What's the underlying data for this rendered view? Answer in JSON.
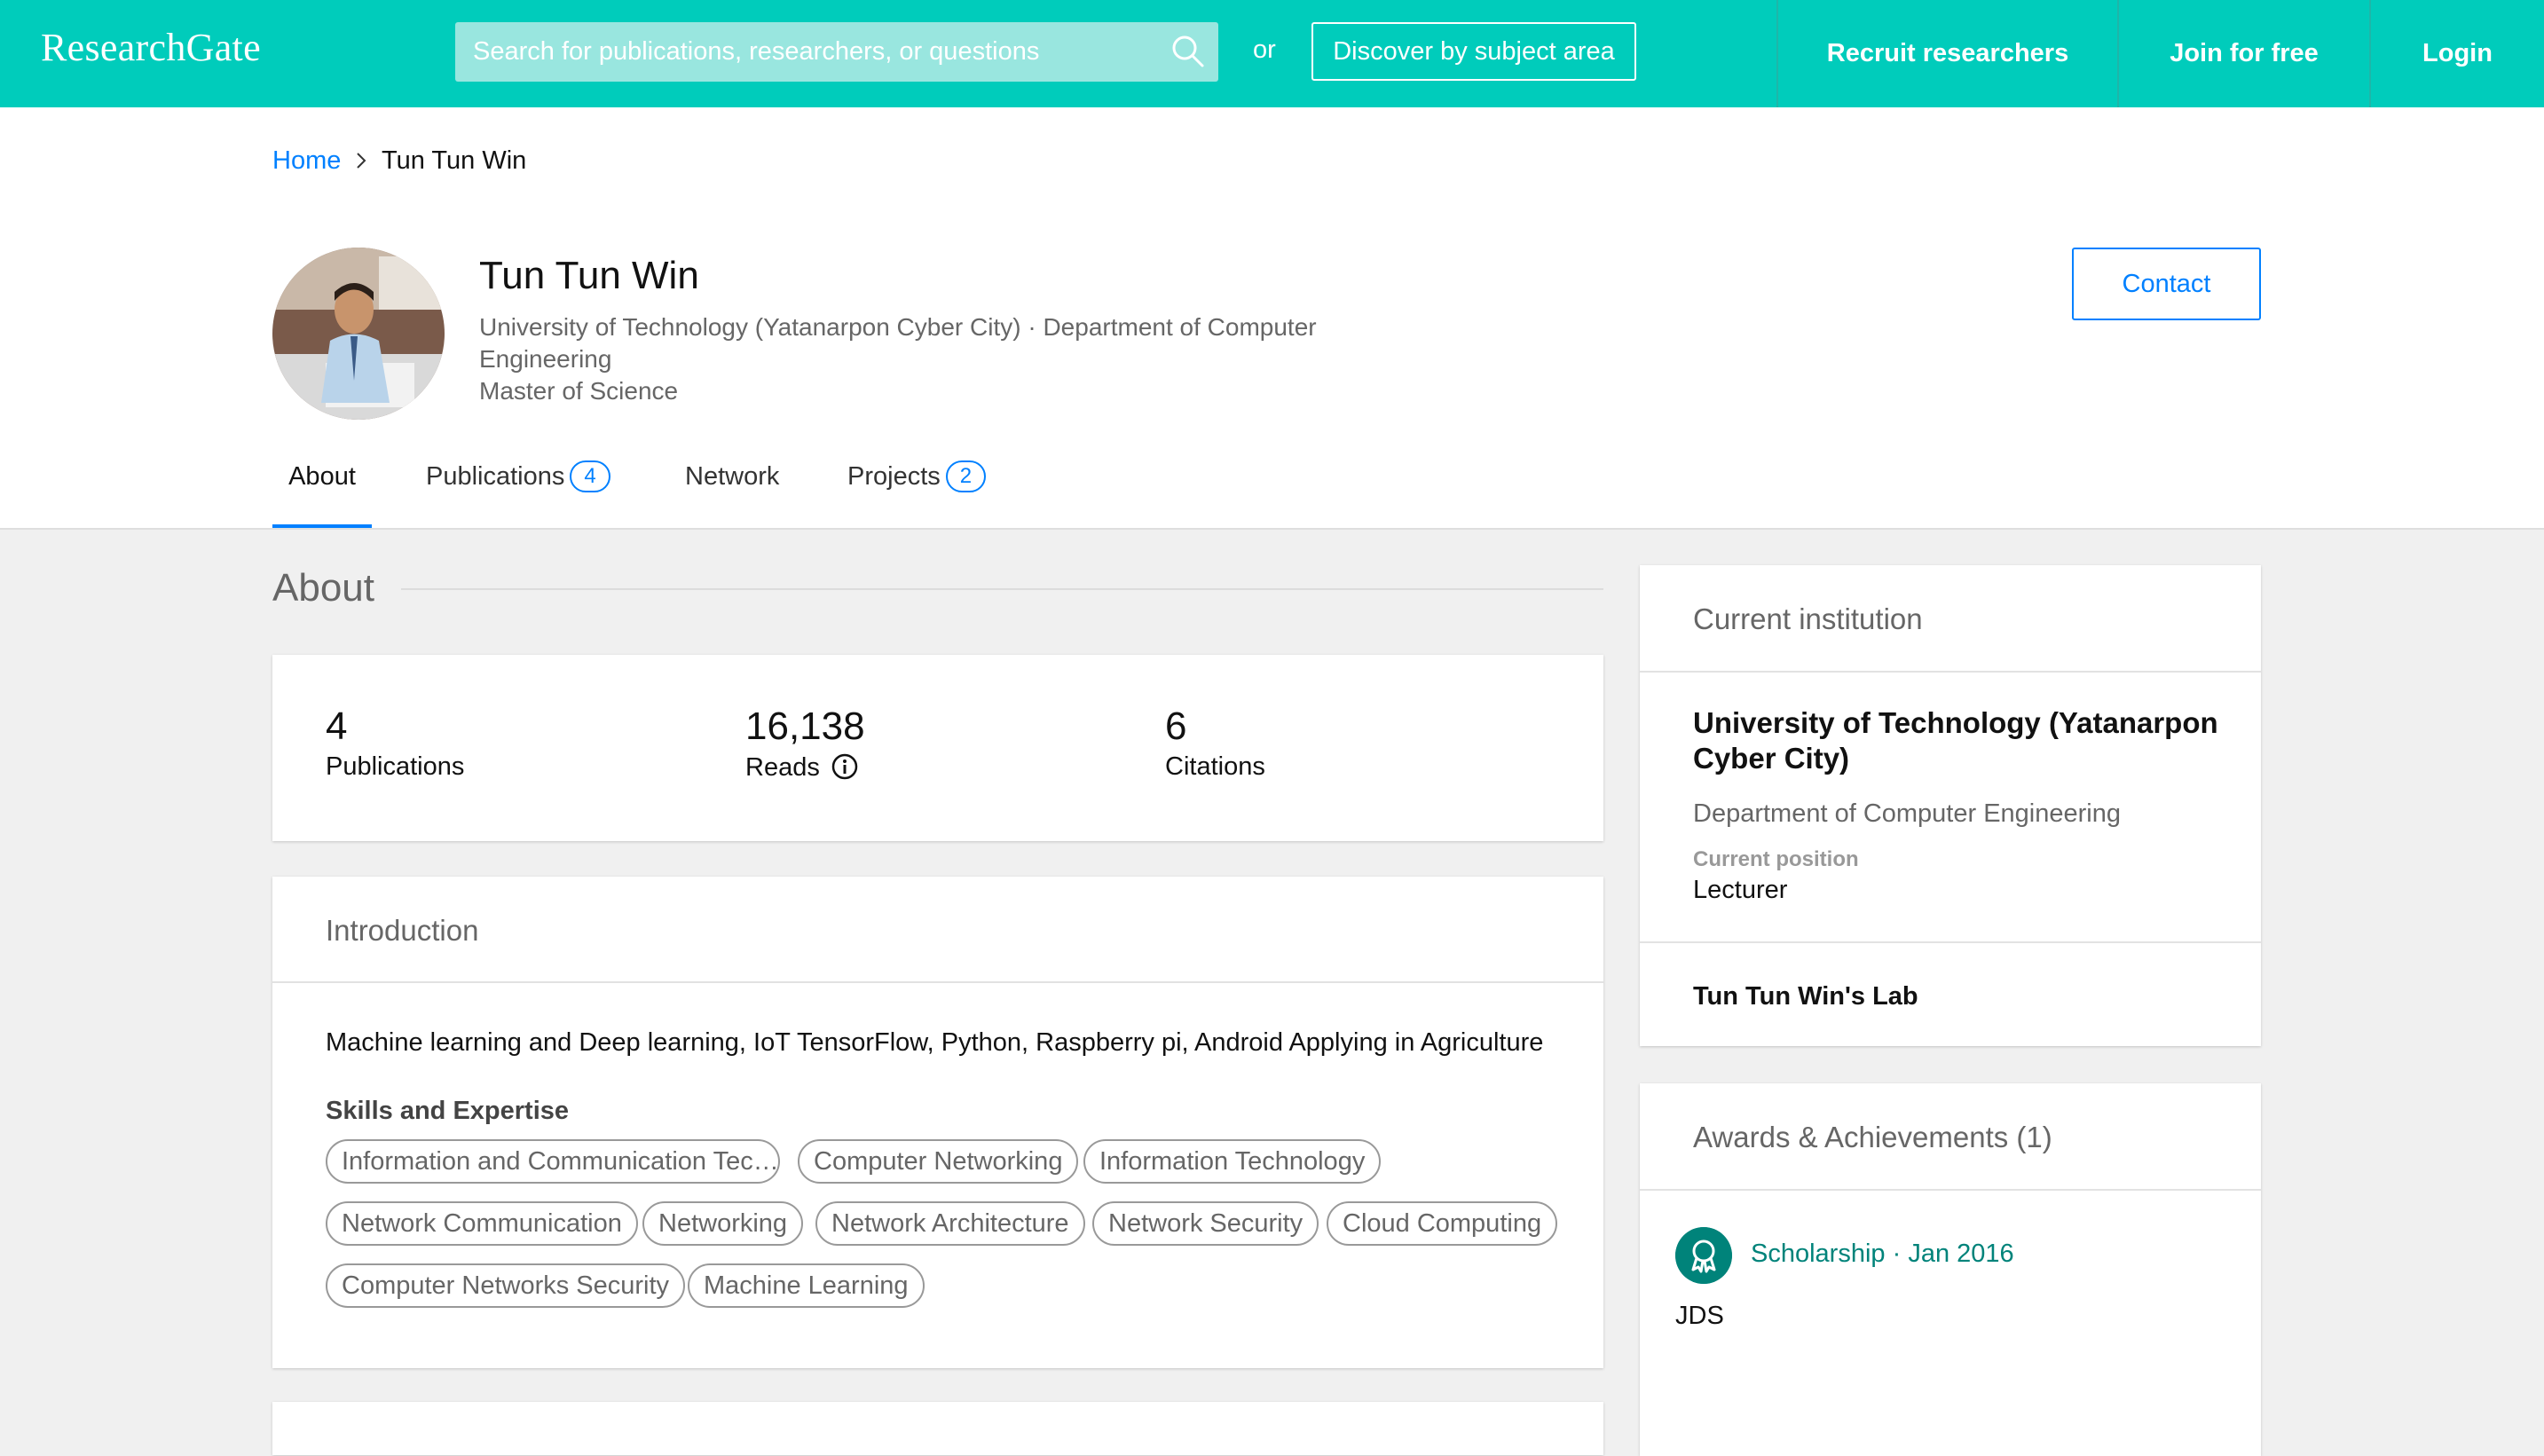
{
  "header": {
    "logo": "ResearchGate",
    "search_placeholder": "Search for publications, researchers, or questions",
    "or_text": "or",
    "discover_label": "Discover by subject area",
    "recruit_label": "Recruit researchers",
    "join_label": "Join for free",
    "login_label": "Login",
    "colors": {
      "brand": "#00ccbb"
    }
  },
  "breadcrumb": {
    "home": "Home",
    "current": "Tun Tun Win"
  },
  "profile": {
    "name": "Tun Tun Win",
    "affiliation": "University of Technology (Yatanarpon Cyber City) · Department of Computer Engineering",
    "degree": "Master of Science",
    "contact_label": "Contact",
    "avatar_icon": "person-photo"
  },
  "tabs": [
    {
      "label": "About",
      "active": true
    },
    {
      "label": "Publications",
      "count": "4"
    },
    {
      "label": "Network"
    },
    {
      "label": "Projects",
      "count": "2"
    }
  ],
  "about": {
    "title": "About",
    "stats": [
      {
        "value": "4",
        "label": "Publications"
      },
      {
        "value": "16,138",
        "label": "Reads"
      },
      {
        "value": "6",
        "label": "Citations"
      }
    ],
    "introduction": {
      "title": "Introduction",
      "text": "Machine learning and Deep learning, IoT TensorFlow, Python, Raspberry pi, Android Applying in Agriculture",
      "skills_title": "Skills and Expertise",
      "skills": [
        "Information and Communication Tec…",
        "Computer Networking",
        "Information Technology",
        "Network Communication",
        "Networking",
        "Network Architecture",
        "Network Security",
        "Cloud Computing",
        "Computer Networks Security",
        "Machine Learning"
      ]
    }
  },
  "institution": {
    "title": "Current institution",
    "name": "University of Technology (Yatanarpon Cyber City)",
    "department": "Department of Computer Engineering",
    "position_label": "Current position",
    "position": "Lecturer",
    "lab": "Tun Tun Win's Lab"
  },
  "awards": {
    "title": "Awards & Achievements (1)",
    "items": [
      {
        "type": "Scholarship",
        "separator": " · ",
        "date": "Jan 2016",
        "description": "JDS"
      }
    ]
  }
}
